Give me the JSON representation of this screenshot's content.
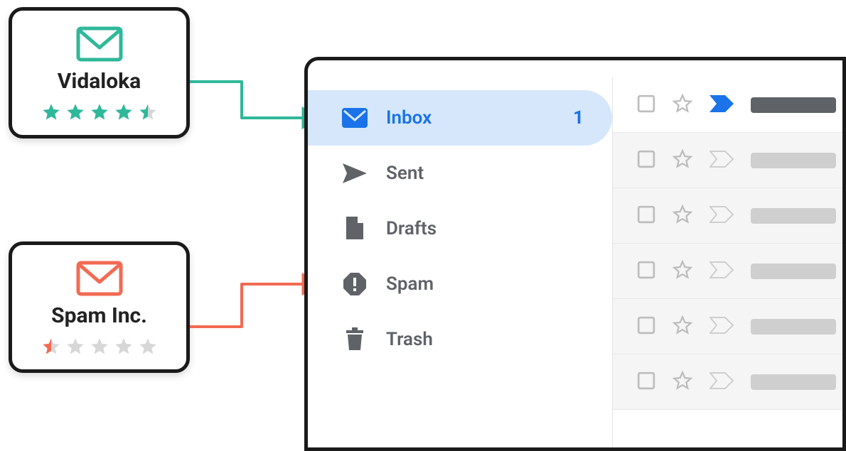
{
  "cards": {
    "good": {
      "name": "Vidaloka",
      "rating": 4.5,
      "color": "#2fb89a"
    },
    "bad": {
      "name": "Spam Inc.",
      "rating": 0.5,
      "color": "#f16b52"
    }
  },
  "sidebar": {
    "items": [
      {
        "id": "inbox",
        "label": "Inbox",
        "count": "1",
        "active": true
      },
      {
        "id": "sent",
        "label": "Sent"
      },
      {
        "id": "drafts",
        "label": "Drafts"
      },
      {
        "id": "spam",
        "label": "Spam"
      },
      {
        "id": "trash",
        "label": "Trash"
      }
    ]
  },
  "messages": [
    {
      "important": true,
      "unread": true
    },
    {
      "important": false,
      "unread": false
    },
    {
      "important": false,
      "unread": false
    },
    {
      "important": false,
      "unread": false
    },
    {
      "important": false,
      "unread": false
    },
    {
      "important": false,
      "unread": false
    }
  ]
}
